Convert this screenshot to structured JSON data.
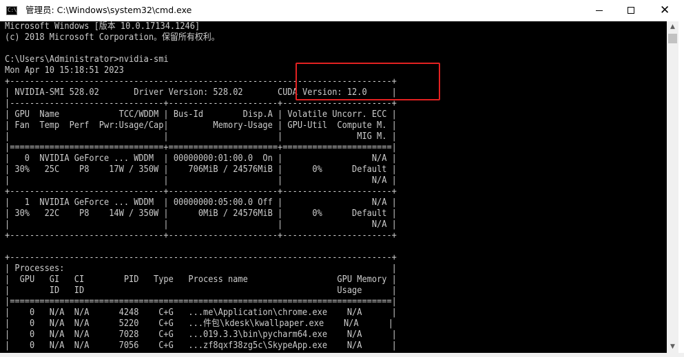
{
  "window": {
    "title": "管理员: C:\\Windows\\system32\\cmd.exe",
    "app_icon_text": "C:\\",
    "controls": {
      "minimize": "minimize-icon",
      "maximize": "maximize-icon",
      "close": "✕"
    }
  },
  "console": {
    "lines": [
      "Microsoft Windows [版本 10.0.17134.1246]",
      "(c) 2018 Microsoft Corporation。保留所有权利。",
      "",
      "C:\\Users\\Administrator>nvidia-smi",
      "Mon Apr 10 15:18:51 2023",
      "+-----------------------------------------------------------------------------+",
      "| NVIDIA-SMI 528.02       Driver Version: 528.02       CUDA Version: 12.0     |",
      "|-------------------------------+----------------------+----------------------+",
      "| GPU  Name            TCC/WDDM | Bus-Id        Disp.A | Volatile Uncorr. ECC |",
      "| Fan  Temp  Perf  Pwr:Usage/Cap|         Memory-Usage | GPU-Util  Compute M. |",
      "|                               |                      |               MIG M. |",
      "|===============================+======================+======================|",
      "|   0  NVIDIA GeForce ... WDDM  | 00000000:01:00.0  On |                  N/A |",
      "| 30%   25C    P8    17W / 350W |    706MiB / 24576MiB |      0%      Default |",
      "|                               |                      |                  N/A |",
      "+-------------------------------+----------------------+----------------------+",
      "|   1  NVIDIA GeForce ... WDDM  | 00000000:05:00.0 Off |                  N/A |",
      "| 30%   22C    P8    14W / 350W |      0MiB / 24576MiB |      0%      Default |",
      "|                               |                      |                  N/A |",
      "+-------------------------------+----------------------+----------------------+",
      "",
      "+-----------------------------------------------------------------------------+",
      "| Processes:                                                                  |",
      "|  GPU   GI   CI        PID   Type   Process name                  GPU Memory |",
      "|        ID   ID                                                   Usage      |",
      "|=============================================================================|",
      "|    0   N/A  N/A      4248    C+G   ...me\\Application\\chrome.exe    N/A      |",
      "|    0   N/A  N/A      5220    C+G   ...件包\\kdesk\\kwallpaper.exe    N/A      |",
      "|    0   N/A  N/A      7028    C+G   ...019.3.3\\bin\\pycharm64.exe    N/A      |",
      "|    0   N/A  N/A      7056    C+G   ...zf8qxf38zg5c\\SkypeApp.exe    N/A      |"
    ]
  },
  "scrollbar": {
    "up": "▲",
    "down": "▼"
  },
  "colors": {
    "console_bg": "#000000",
    "console_text": "#cccccc",
    "highlight": "#e32121"
  }
}
